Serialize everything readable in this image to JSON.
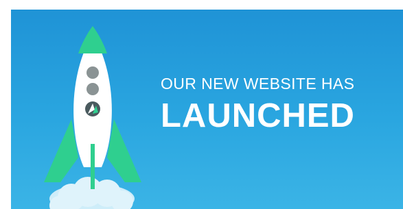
{
  "headline": {
    "line1": "OUR NEW WEBSITE HAS",
    "line2": "LAUNCHED"
  },
  "colors": {
    "background_top": "#1f93d6",
    "background_bottom": "#3bb4e6",
    "rocket_green": "#2fcf8f",
    "rocket_body": "#ffffff",
    "window_gray": "#8a9394",
    "text": "#ffffff"
  },
  "icons": [
    "rocket-illustration",
    "smoke-cloud",
    "logo-emblem"
  ]
}
